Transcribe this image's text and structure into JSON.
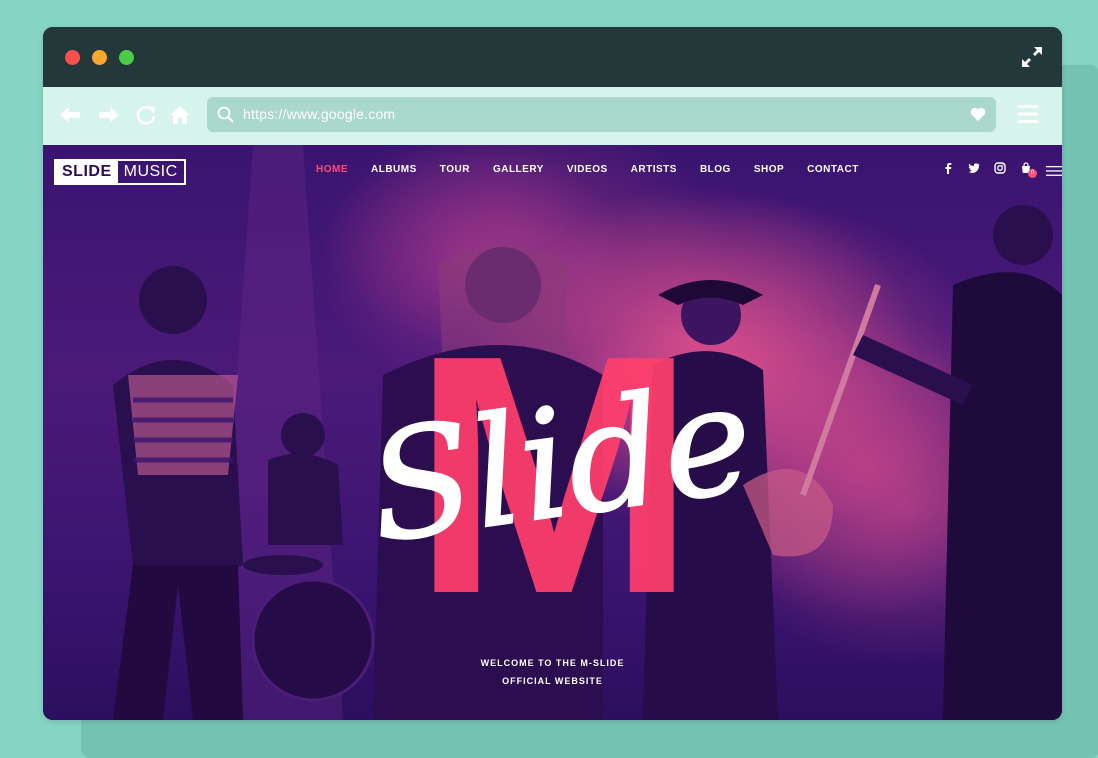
{
  "browser": {
    "url": "https://www.google.com",
    "colors": {
      "titlebar": "#233838",
      "toolbar": "#d6f3ec",
      "urlbar": "#aad8cd",
      "background": "#86d4c4"
    },
    "icons": [
      "back-arrow-icon",
      "forward-arrow-icon",
      "reload-icon",
      "home-icon",
      "search-icon",
      "heart-icon",
      "menu-icon",
      "expand-icon"
    ]
  },
  "site": {
    "logo": {
      "bold": "SLIDE",
      "light": "MUSIC"
    },
    "nav": {
      "home": "HOME",
      "albums": "ALBUMS",
      "tour": "TOUR",
      "gallery": "GALLERY",
      "videos": "VIDEOS",
      "artists": "ARTISTS",
      "blog": "BLOG",
      "shop": "SHOP",
      "contact": "CONTACT"
    },
    "cart_count": "0",
    "hero": {
      "big_letter": "M",
      "script_word": "Slide",
      "welcome_line1": "WELCOME TO THE M-SLIDE",
      "welcome_line2": "OFFICIAL WEBSITE"
    },
    "colors": {
      "accent": "#ff4d7a",
      "hero_overlay": "#3a1470"
    }
  }
}
